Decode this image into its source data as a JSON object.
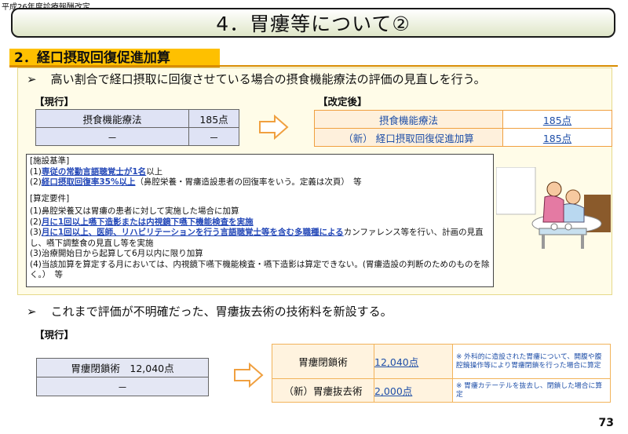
{
  "header": {
    "note": "平成26年度診療報酬改定",
    "title": "4．胃瘻等について②"
  },
  "section2": {
    "heading": "2．経口摂取回復促進加算",
    "bullet_mark": "➢",
    "bullet_text": "高い割合で経口摂取に回復させている場合の摂食機能療法の評価の見直しを行う。",
    "current_label": "【現行】",
    "revised_label": "【改定後】",
    "current_table": [
      [
        "摂食機能療法",
        "185点"
      ],
      [
        "－",
        "－"
      ]
    ],
    "revised_table": [
      [
        "摂食機能療法",
        "185点"
      ],
      [
        "（新） 経口摂取回復促進加算",
        "185点"
      ]
    ],
    "criteria": {
      "facility_heading": "[施設基準]",
      "facility_items": [
        {
          "prefix": "(1)",
          "link": "専従の常勤言語聴覚士が1名",
          "suffix": "以上"
        },
        {
          "prefix": "(2)",
          "link": "経口摂取回復率35%以上",
          "suffix": "（鼻腔栄養・胃瘻造設患者の回復率をいう。定義は次頁）　等"
        }
      ],
      "calc_heading": "[算定要件]",
      "calc_items": [
        {
          "prefix": "(1)",
          "link": "",
          "suffix": "鼻腔栄養又は胃瘻の患者に対して実施した場合に加算"
        },
        {
          "prefix": "(2)",
          "link": "月に1回以上嚥下造影または内視鏡下嚥下機能検査を実施",
          "suffix": ""
        },
        {
          "prefix": "(3)",
          "link": "月に1回以上、医師、リハビリテーションを行う言語聴覚士等を含む多職種による",
          "suffix": "カンファレンス等を行い、計画の見直し、嚥下調整食の見直し等を実施"
        },
        {
          "prefix": "(3)",
          "link": "",
          "suffix": "治療開始日から起算して6月以内に限り加算"
        },
        {
          "prefix": "(4)",
          "link": "",
          "suffix": "当該加算を算定する月においては、内視鏡下嚥下機能検査・嚥下造影は算定できない。(胃瘻造設の判断のためのものを除く。）　等"
        }
      ]
    }
  },
  "section3": {
    "bullet_mark": "➢",
    "bullet_text": "これまで評価が不明確だった、胃瘻抜去術の技術料を新設する。",
    "current_label": "【現行】",
    "current_table": [
      [
        "胃瘻閉鎖術　12,040点"
      ],
      [
        "－"
      ]
    ],
    "revised_table": [
      {
        "name": "胃瘻閉鎖術",
        "value": "12,040点",
        "note": "※ 外科的に造設された胃瘻について、開腹や腹腔鏡操作等により胃瘻閉鎖を行った場合に算定"
      },
      {
        "name": "（新）胃瘻抜去術",
        "value": "2,000点",
        "note": "※ 胃瘻カテーテルを抜去し、閉鎖した場合に算定"
      }
    ]
  },
  "page_number": "73",
  "colors": {
    "accent_orange": "#fec000",
    "link_blue": "#2549b8",
    "panel_bg": "#fffce8",
    "current_cell": "#dfe3f5",
    "revised_cell": "#fef0dc"
  }
}
